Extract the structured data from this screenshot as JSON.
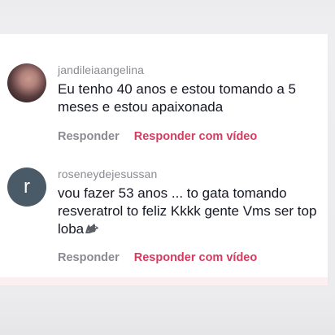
{
  "comments": [
    {
      "username": "jandileiaangelina",
      "text": "Eu tenho 40 anos e estou tomando a 5 meses e estou apaixonada",
      "avatar": {
        "type": "photo"
      },
      "actions": {
        "reply": "Responder",
        "reply_video": "Responder com vídeo"
      }
    },
    {
      "username": "roseneydejesussan",
      "text": "vou fazer 53 anos ... to gata tomando resveratrol to feliz Kkkk gente Vms ser top loba",
      "emoji": "wolf-emoji",
      "avatar": {
        "type": "letter",
        "letter": "r",
        "color": "#4a5a66"
      },
      "actions": {
        "reply": "Responder",
        "reply_video": "Responder com vídeo"
      }
    }
  ],
  "colors": {
    "accent": "#d63a5f",
    "muted": "#8a8b91",
    "text": "#161823"
  }
}
